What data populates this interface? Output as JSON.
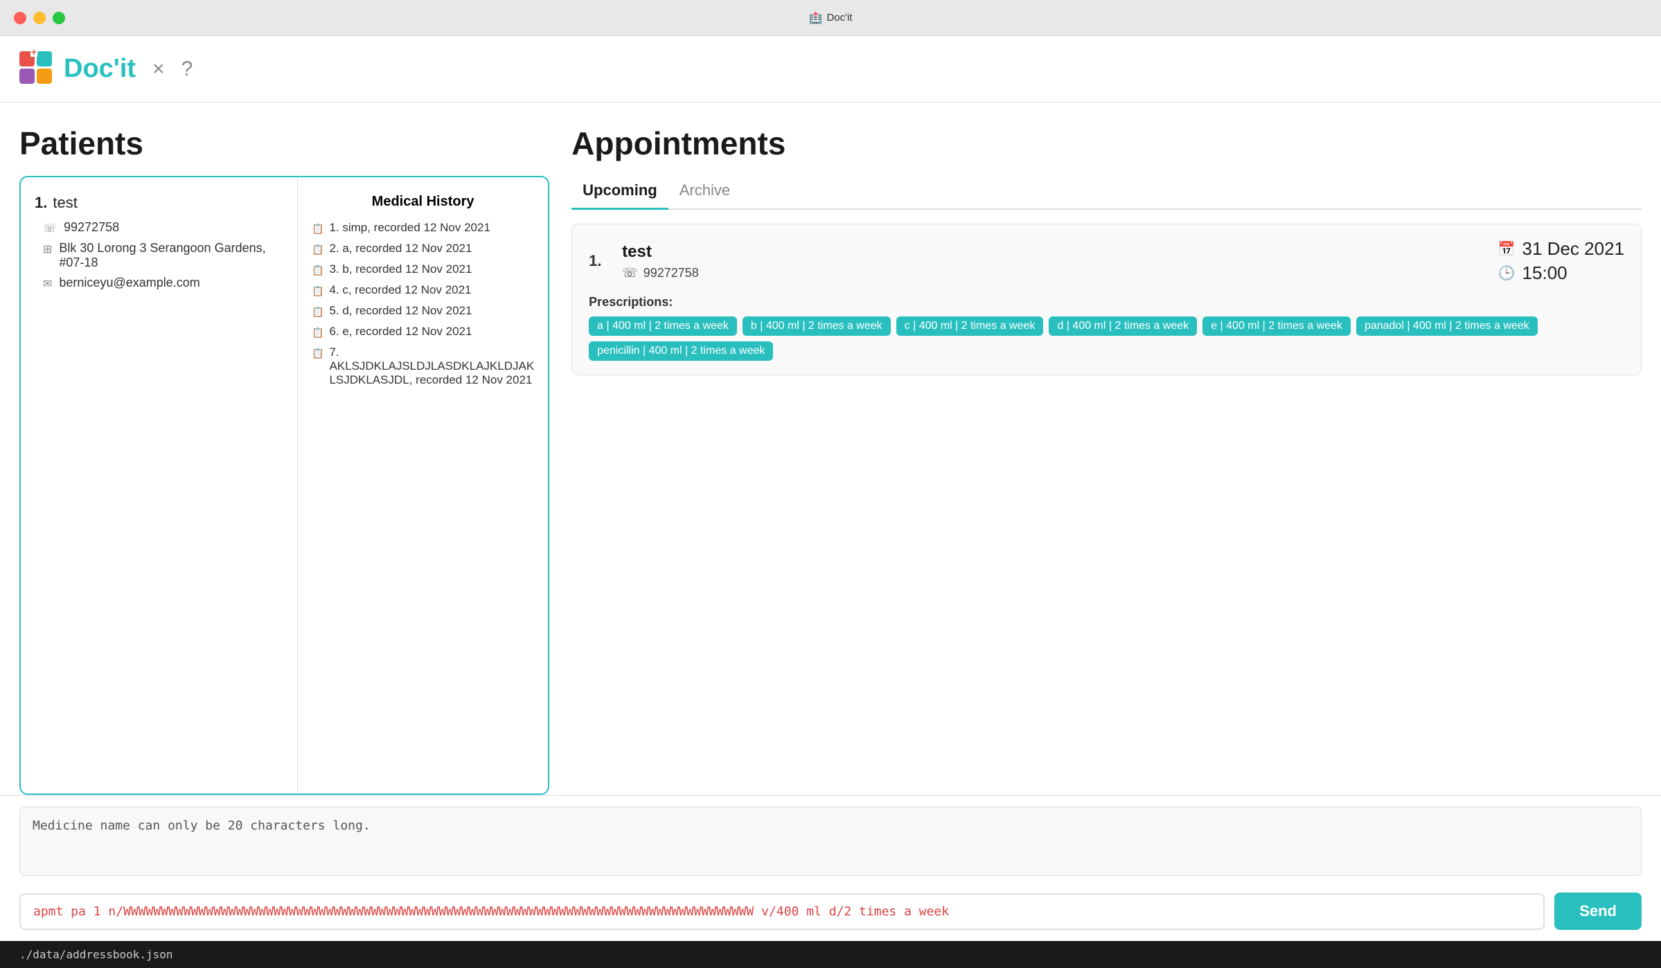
{
  "titlebar": {
    "app_name": "Doc'it"
  },
  "header": {
    "app_name": "Doc'it",
    "close_label": "×",
    "help_label": "?"
  },
  "patients_panel": {
    "title": "Patients",
    "patient": {
      "number": "1.",
      "name": "test",
      "phone": "99272758",
      "address": "Blk 30 Lorong 3 Serangoon Gardens, #07-18",
      "email": "berniceyu@example.com"
    },
    "medical_history": {
      "title": "Medical History",
      "items": [
        "1. simp, recorded 12 Nov 2021",
        "2. a, recorded 12 Nov 2021",
        "3. b, recorded 12 Nov 2021",
        "4. c, recorded 12 Nov 2021",
        "5. d, recorded 12 Nov 2021",
        "6. e, recorded 12 Nov 2021",
        "7. AKLSJDKLAJSLDJLASDKLAJKLDJAK LSJDKLASJDL, recorded 12 Nov 2021"
      ]
    }
  },
  "appointments_panel": {
    "title": "Appointments",
    "tabs": [
      {
        "id": "upcoming",
        "label": "Upcoming",
        "active": true
      },
      {
        "id": "archive",
        "label": "Archive",
        "active": false
      }
    ],
    "appointment": {
      "number": "1.",
      "patient_name": "test",
      "phone": "99272758",
      "date": "31 Dec 2021",
      "time": "15:00",
      "prescriptions_label": "Prescriptions:",
      "prescriptions": [
        "a | 400 ml | 2 times a week",
        "b | 400 ml | 2 times a week",
        "c | 400 ml | 2 times a week",
        "d | 400 ml | 2 times a week",
        "e | 400 ml | 2 times a week",
        "panadol | 400 ml | 2 times a week",
        "penicillin | 400 ml | 2 times a week"
      ]
    }
  },
  "message_area": {
    "text": "Medicine name can only be 20 characters long."
  },
  "command_bar": {
    "input_value": "apmt pa 1 n/WWWWWWWWWWWWWWWWWWWWWWWWWWWWWWWWWWWWWWWWWWWWWWWWWWWWWWWWWWWWWWWWWWWWWWWWWWWWWWWWWWWW v/400 ml d/2 times a week",
    "send_label": "Send"
  },
  "status_bar": {
    "path": "./data/addressbook.json"
  },
  "colors": {
    "teal": "#2abfbf",
    "red": "#e8524a",
    "yellow": "#febc2e",
    "green": "#28c840"
  }
}
